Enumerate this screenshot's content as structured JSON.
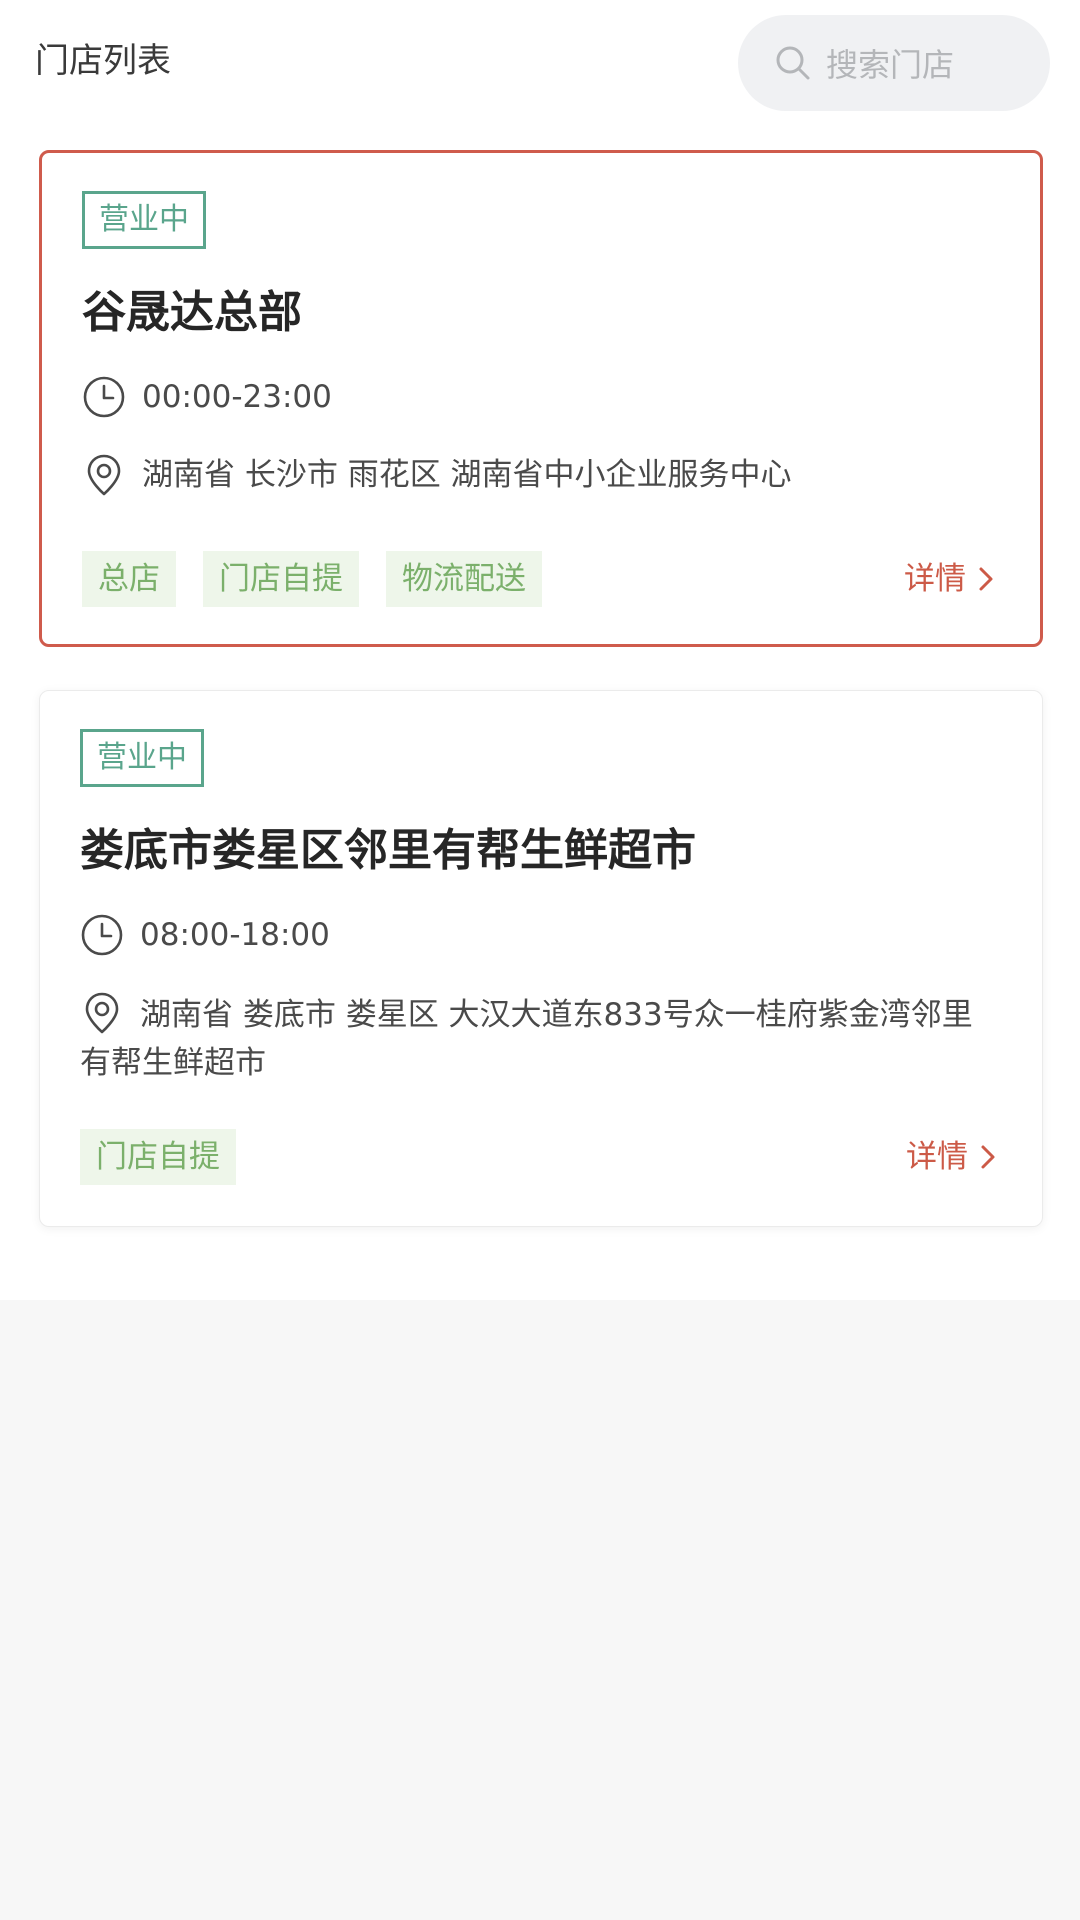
{
  "header": {
    "title": "门店列表",
    "search_placeholder": "搜索门店"
  },
  "stores": [
    {
      "status": "营业中",
      "name": "谷晟达总部",
      "hours": "00:00-23:00",
      "address": "湖南省 长沙市 雨花区 湖南省中小企业服务中心",
      "tags": [
        "总店",
        "门店自提",
        "物流配送"
      ],
      "details_label": "详情",
      "selected": true
    },
    {
      "status": "营业中",
      "name": "娄底市娄星区邻里有帮生鲜超市",
      "hours": "08:00-18:00",
      "address": "湖南省 娄底市 娄星区 大汉大道东833号众一桂府紫金湾邻里有帮生鲜超市",
      "tags": [
        "门店自提"
      ],
      "details_label": "详情",
      "selected": false
    }
  ],
  "icons": {
    "search": "search-icon",
    "clock": "clock-icon",
    "location": "location-pin-icon",
    "chevron": "chevron-right-icon"
  },
  "colors": {
    "accent": "#cf5b4c",
    "status": "#5aa58c",
    "tag_text": "#7bb06b",
    "tag_bg": "#eef6ea"
  }
}
